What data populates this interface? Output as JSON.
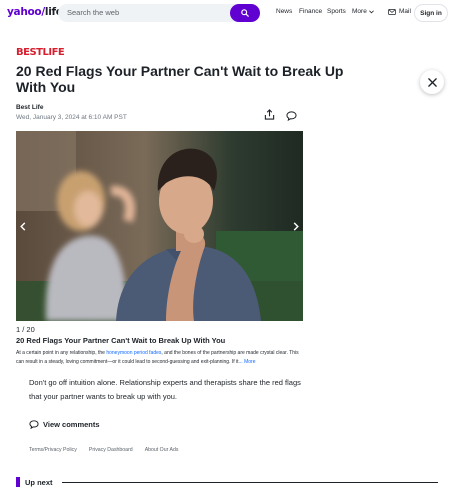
{
  "header": {
    "logo_yahoo": "yahoo",
    "logo_slash": "/",
    "logo_section": "life",
    "search_placeholder": "Search the web",
    "nav": [
      "News",
      "Finance",
      "Sports",
      "More"
    ],
    "mail_label": "Mail",
    "signin_label": "Sign in"
  },
  "article": {
    "brand": "BESTLIFE",
    "title": "20 Red Flags Your Partner Can't Wait to Break Up With You",
    "author": "Best Life",
    "date": "Wed, January 3, 2024 at 6:10 AM PST"
  },
  "slideshow": {
    "counter": "1 / 20",
    "caption": "20 Red Flags Your Partner Can't Wait to Break Up With You",
    "desc_before": "At a certain point in any relationship, the ",
    "desc_link": "honeymoon period fades",
    "desc_after": ", and the bones of the partnership are made crystal clear. This can result in a steady, loving commitment—or it could lead to second-guessing and exit-planning. If it",
    "desc_more": "... More"
  },
  "body": {
    "paragraph": "Don't go off intuition alone. Relationship experts and therapists share the red flags that your partner wants to break up with you.",
    "view_comments": "View comments"
  },
  "footer": {
    "links": [
      "Terms/Privacy Policy",
      "Privacy Dashboard",
      "About Our Ads"
    ]
  },
  "upnext": {
    "label": "Up next"
  },
  "colors": {
    "accent": "#6001d2",
    "brand_red": "#d6202f",
    "link": "#0f69ff"
  }
}
